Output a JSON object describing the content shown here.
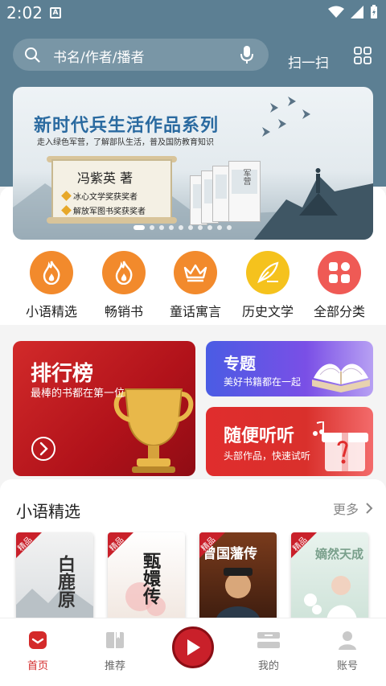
{
  "status": {
    "time": "2:02",
    "notice": "A"
  },
  "search": {
    "placeholder": "书名/作者/播者",
    "scan": "扫一扫"
  },
  "banner": {
    "title": "新时代兵生活作品系列",
    "subtitle": "走入绿色军营，了解部队生活，普及国防教育知识",
    "author": "冯紫英 著",
    "awards": [
      "冰心文学奖获奖者",
      "解放军图书奖获奖者"
    ],
    "book_spine": "军营"
  },
  "categories": [
    {
      "label": "小语精选",
      "icon": "flame-icon",
      "color": "#f28a2c"
    },
    {
      "label": "畅销书",
      "icon": "flame-icon",
      "color": "#f28a2c"
    },
    {
      "label": "童话寓言",
      "icon": "crown-icon",
      "color": "#f28a2c"
    },
    {
      "label": "历史文学",
      "icon": "quill-icon",
      "color": "#f5c21d"
    },
    {
      "label": "全部分类",
      "icon": "grid-icon",
      "color": "#ef5a55"
    }
  ],
  "cards": {
    "rank": {
      "title": "排行榜",
      "subtitle": "最棒的书都在第一位"
    },
    "topic": {
      "title": "专题",
      "subtitle": "美好书籍都在一起"
    },
    "listen": {
      "title": "随便听听",
      "subtitle": "头部作品，快速试听"
    }
  },
  "section": {
    "title": "小语精选",
    "more": "更多",
    "books": [
      {
        "badge": "精品",
        "title": "白鹿原"
      },
      {
        "badge": "精品",
        "title": "甄嬛传"
      },
      {
        "badge": "精品",
        "title": "曾国藩传"
      },
      {
        "badge": "精品",
        "title": "嫡然天成"
      }
    ]
  },
  "tabs": [
    {
      "label": "首页",
      "icon": "home-icon",
      "active": true
    },
    {
      "label": "推荐",
      "icon": "book-icon",
      "active": false
    },
    {
      "label": "",
      "icon": "play-icon",
      "active": false
    },
    {
      "label": "我的",
      "icon": "shelf-icon",
      "active": false
    },
    {
      "label": "账号",
      "icon": "person-icon",
      "active": false
    }
  ],
  "colors": {
    "accent": "#d42a2a",
    "header": "#5c7f93",
    "topic_card": "#5a5ce8"
  }
}
